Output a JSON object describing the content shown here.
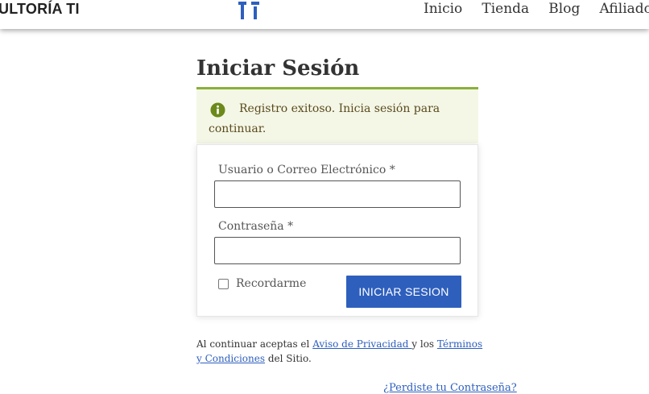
{
  "header": {
    "brand": "ULTORÍA TI",
    "logo_icon": "ti-logo-icon",
    "nav": [
      {
        "label": "Inicio"
      },
      {
        "label": "Tienda"
      },
      {
        "label": "Blog"
      },
      {
        "label": "Afiliados"
      }
    ]
  },
  "page": {
    "title": "Iniciar Sesión"
  },
  "notice": {
    "icon": "info-icon",
    "text": "Registro exitoso. Inicia sesión para continuar."
  },
  "form": {
    "username_label": "Usuario o Correo Electrónico *",
    "username_value": "",
    "password_label": "Contraseña *",
    "password_value": "",
    "remember_label": "Recordarme",
    "remember_checked": false,
    "submit_label": "INICIAR SESION"
  },
  "legal": {
    "prefix": "Al continuar aceptas el ",
    "privacy_link": "Aviso de Privacidad ",
    "middle": "y los ",
    "terms_link": "Términos y Condiciones",
    "suffix": " del Sitio."
  },
  "forgot_link": "¿Perdiste tu Contraseña?",
  "colors": {
    "accent": "#2e5fbd",
    "notice_rule": "#8ab038",
    "notice_bg": "#f4f7e6",
    "info_icon": "#6b8a1a"
  }
}
